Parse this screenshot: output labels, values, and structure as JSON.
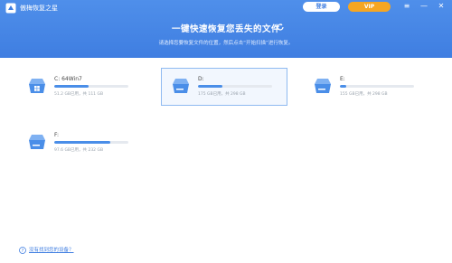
{
  "app": {
    "title": "傲梅恢复之星"
  },
  "header": {
    "login_label": "登录",
    "vip_label": "VIP",
    "menu_glyph": "≡",
    "minimize_glyph": "—",
    "close_glyph": "✕",
    "headline": "一键快速恢复您丢失的文件",
    "subline": "请选择您要恢复文件的位置，然后点击“开始扫描”进行恢复。"
  },
  "drives": [
    {
      "name": "C: 64Win7",
      "usage": "51.2 GB已用，共 111 GB",
      "used_fraction": 0.46,
      "selected": false
    },
    {
      "name": "D:",
      "usage": "175 GB已用，共 298 GB",
      "used_fraction": 0.33,
      "selected": true
    },
    {
      "name": "E:",
      "usage": "155 GB已用，共 298 GB",
      "used_fraction": 0.08,
      "selected": false
    },
    {
      "name": "F:",
      "usage": "97.6 GB已用，共 232 GB",
      "used_fraction": 0.75,
      "selected": false
    }
  ],
  "footer": {
    "help_label": "没有找到您的设备？"
  },
  "colors": {
    "header": "#3f7ee1",
    "vip": "#f5a623",
    "bar": "#4a8ee8",
    "selected_border": "#8fbaf1"
  }
}
